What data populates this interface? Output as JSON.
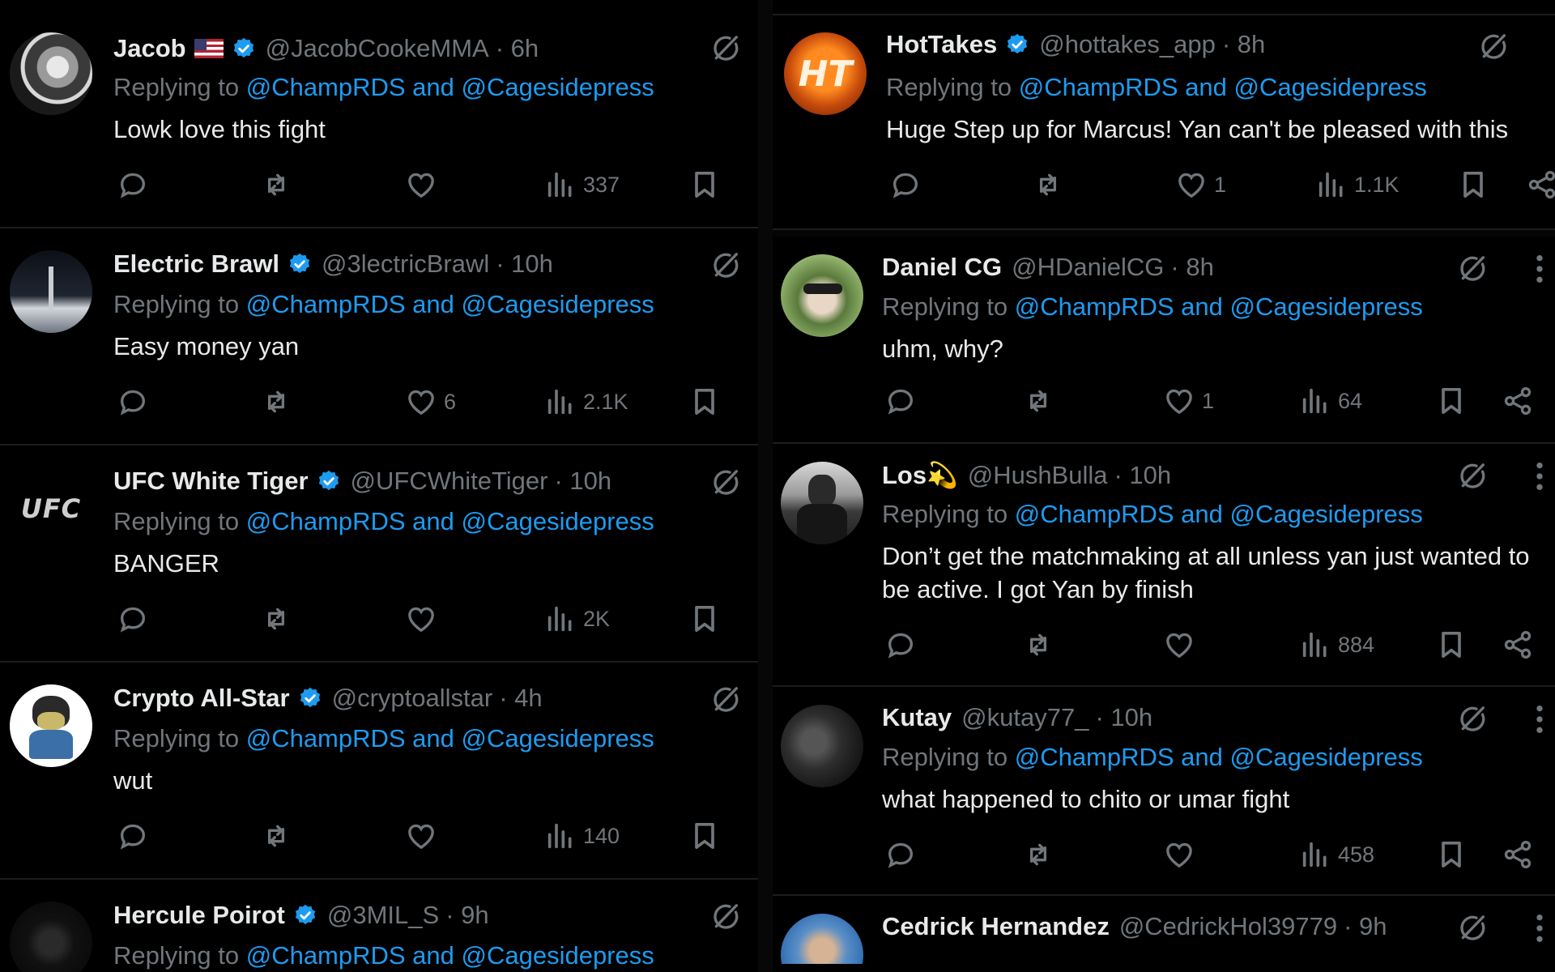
{
  "colors": {
    "background": "#000000",
    "text": "#e7e9ea",
    "muted": "#71767b",
    "link": "#1d9bf0",
    "verified": "#1d9bf0"
  },
  "left_column": {
    "tweets": [
      {
        "name": "Jacob",
        "flag": "🇺🇸",
        "verified": true,
        "handle": "@JacobCookeMMA",
        "time": "· 6h",
        "reply_prefix": "Replying to",
        "reply_targets": "@ChampRDS and @Cagesidepress",
        "text": "Lowk love this fight",
        "likes": "",
        "views": "337",
        "avatar": "fighter-photo"
      },
      {
        "name": "Electric Brawl",
        "verified": true,
        "handle": "@3lectricBrawl",
        "time": "· 10h",
        "reply_prefix": "Replying to",
        "reply_targets": "@ChampRDS and @Cagesidepress",
        "text": "Easy money yan",
        "likes": "6",
        "views": "2.1K",
        "avatar": "monolith-photo"
      },
      {
        "name": "UFC White Tiger",
        "verified": true,
        "handle": "@UFCWhiteTiger",
        "time": "· 10h",
        "reply_prefix": "Replying to",
        "reply_targets": "@ChampRDS and @Cagesidepress",
        "text": "BANGER",
        "likes": "",
        "views": "2K",
        "avatar": "ufc-logo",
        "avatar_text": "UFC"
      },
      {
        "name": "Crypto All-Star",
        "verified": true,
        "handle": "@cryptoallstar",
        "time": "· 4h",
        "reply_prefix": "Replying to",
        "reply_targets": "@ChampRDS and @Cagesidepress",
        "text": "wut",
        "likes": "",
        "views": "140",
        "avatar": "cartoon-character"
      },
      {
        "name": "Hercule Poirot",
        "verified": true,
        "handle": "@3MIL_S",
        "time": "· 9h",
        "reply_prefix": "Replying to",
        "reply_targets": "@ChampRDS and @Cagesidepress",
        "text": "",
        "likes": "",
        "views": "",
        "avatar": "dark-photo"
      }
    ]
  },
  "right_column": {
    "tweets": [
      {
        "name": "HotTakes",
        "verified": true,
        "handle": "@hottakes_app",
        "time": "· 8h",
        "reply_prefix": "Replying to",
        "reply_targets": "@ChampRDS and @Cagesidepress",
        "text": "Huge Step up for Marcus! Yan can't be pleased with this",
        "likes": "1",
        "views": "1.1K",
        "avatar": "hottakes-logo",
        "avatar_text": "HT"
      },
      {
        "name": "Daniel CG",
        "verified": false,
        "handle": "@HDanielCG",
        "time": "· 8h",
        "reply_prefix": "Replying to",
        "reply_targets": "@ChampRDS and @Cagesidepress",
        "text": "uhm, why?",
        "likes": "1",
        "views": "64",
        "avatar": "sunglasses-photo"
      },
      {
        "name": "Los💫",
        "verified": false,
        "handle": "@HushBulla",
        "time": "· 10h",
        "reply_prefix": "Replying to",
        "reply_targets": "@ChampRDS and @Cagesidepress",
        "text": "Don’t get the matchmaking at all unless yan just wanted to be active. I got Yan by finish",
        "likes": "",
        "views": "884",
        "avatar": "mirror-selfie-photo"
      },
      {
        "name": "Kutay",
        "verified": false,
        "handle": "@kutay77_",
        "time": "· 10h",
        "reply_prefix": "Replying to",
        "reply_targets": "@ChampRDS and @Cagesidepress",
        "text": "what happened to chito or umar fight",
        "likes": "",
        "views": "458",
        "avatar": "gym-photo"
      },
      {
        "name": "Cedrick Hernandez",
        "verified": false,
        "handle": "@CedrickHol39779",
        "time": "· 9h",
        "reply_prefix": "",
        "reply_targets": "",
        "text": "",
        "likes": "",
        "views": "",
        "avatar": "outdoor-photo"
      }
    ]
  },
  "icons": [
    "reply-icon",
    "retweet-icon",
    "like-icon",
    "views-icon",
    "bookmark-icon",
    "share-icon",
    "grok-icon",
    "more-icon",
    "verified-badge-icon"
  ]
}
